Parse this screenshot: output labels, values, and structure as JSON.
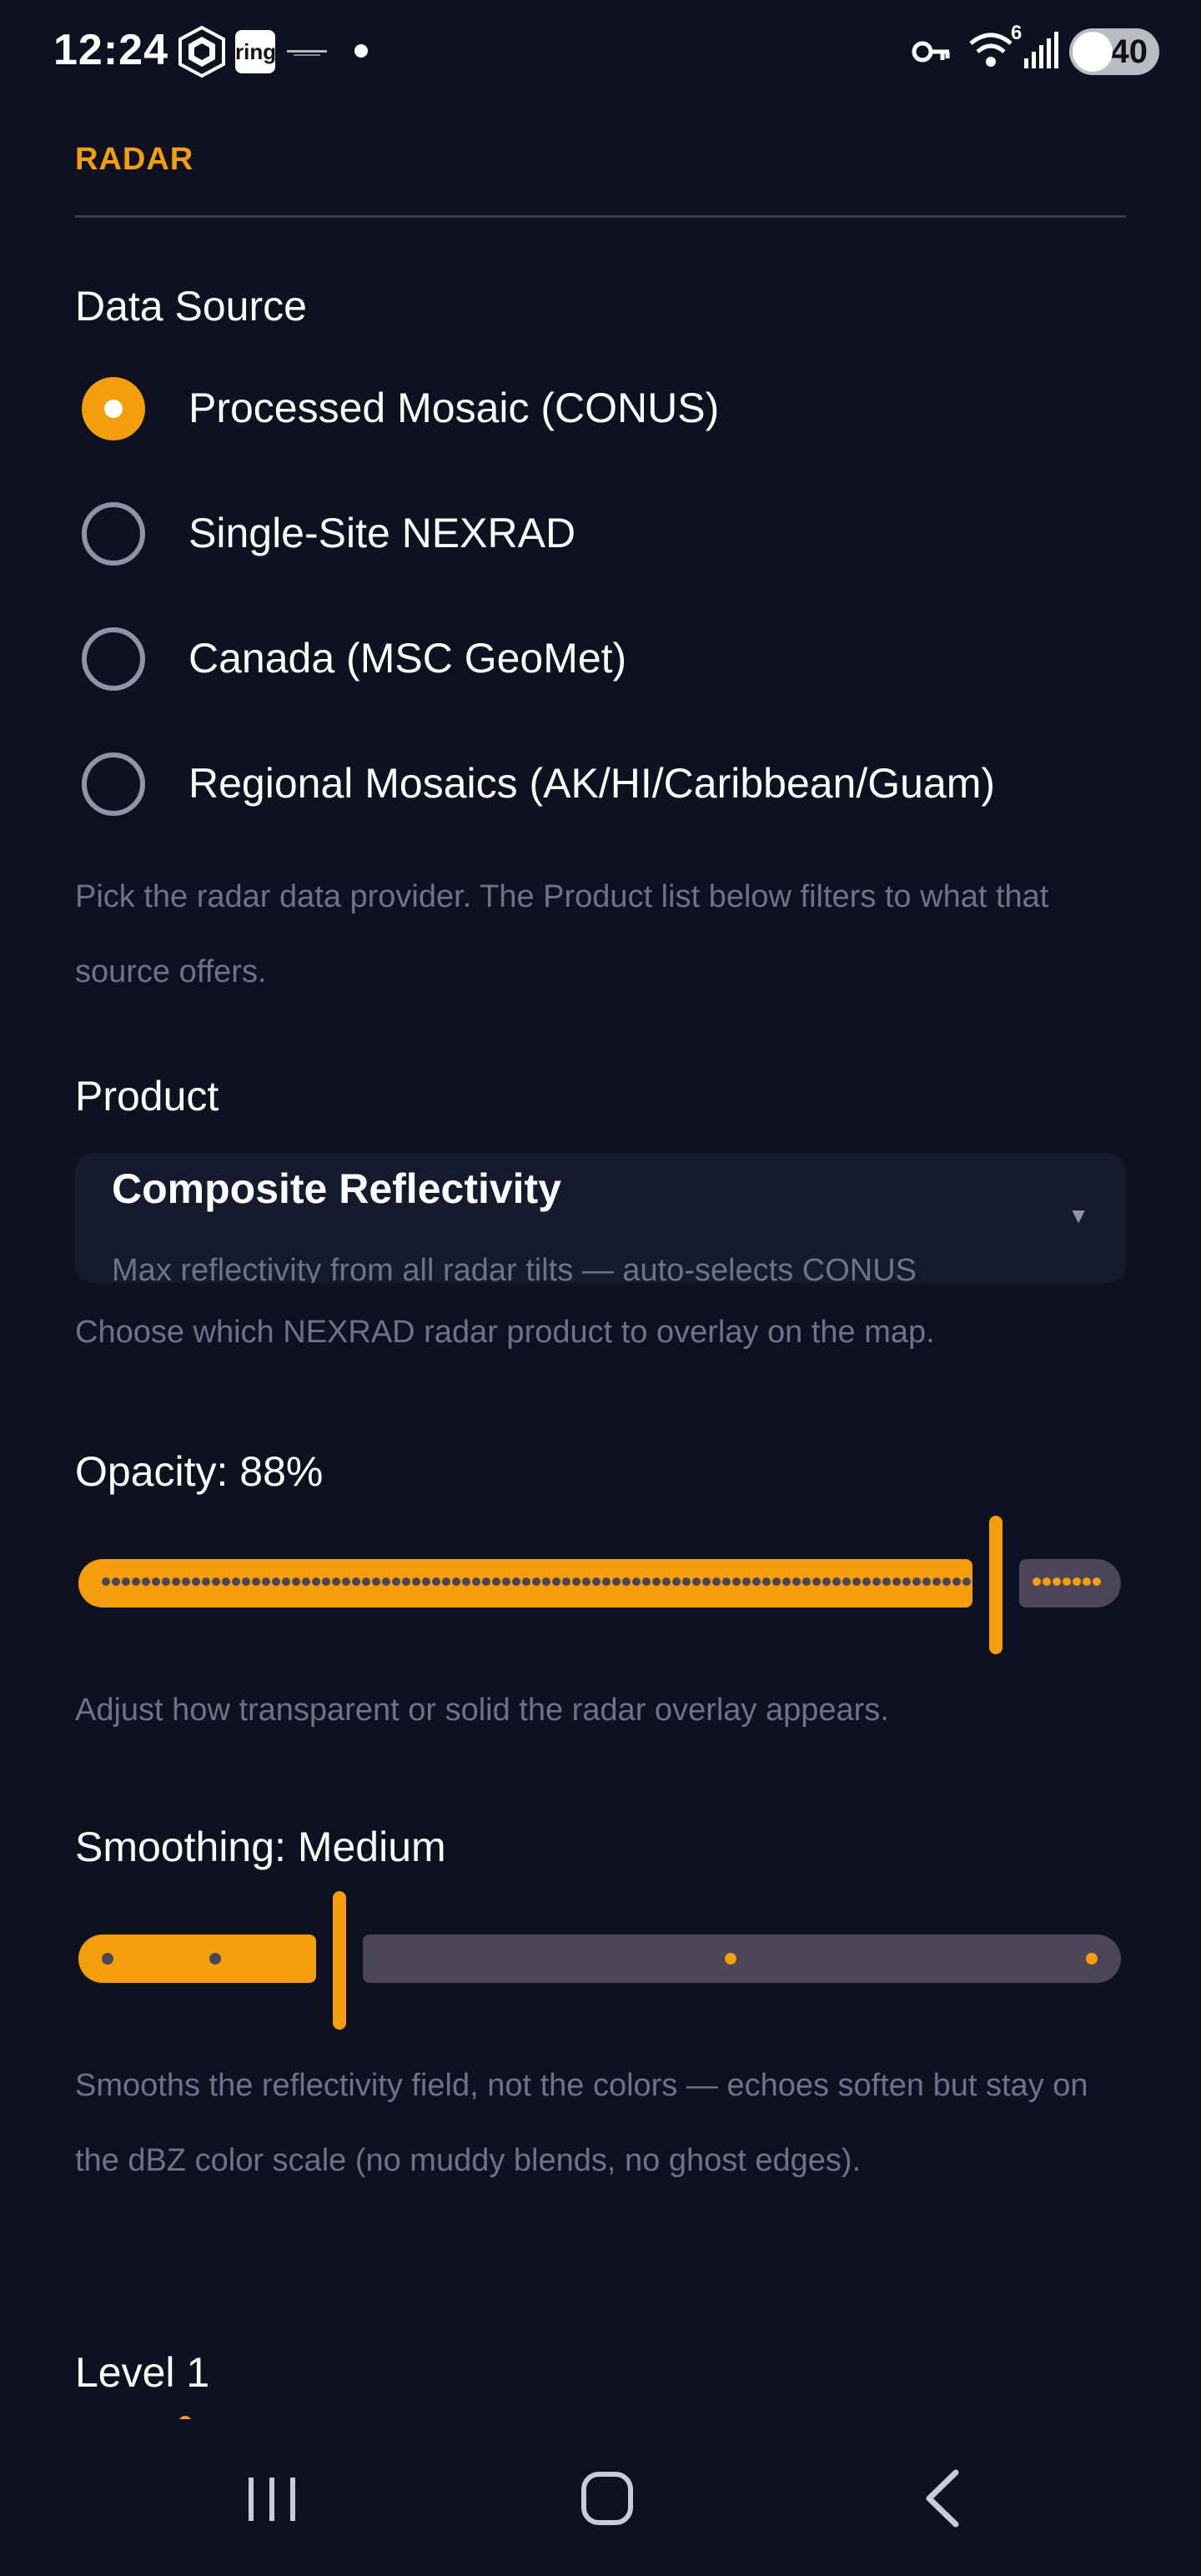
{
  "status_bar": {
    "time": "12:24",
    "notification_icons": [
      "crypto-com-icon",
      "ring-icon",
      "app-logo-icon",
      "dot-icon"
    ],
    "ring_label": "ring",
    "right_icons": [
      "key-icon",
      "wifi-6-icon",
      "signal-icon"
    ],
    "wifi_badge": "6",
    "battery": "40"
  },
  "section": {
    "title": "RADAR"
  },
  "data_source": {
    "label": "Data Source",
    "options": [
      {
        "label": "Processed Mosaic (CONUS)",
        "selected": true
      },
      {
        "label": "Single-Site NEXRAD",
        "selected": false
      },
      {
        "label": "Canada (MSC GeoMet)",
        "selected": false
      },
      {
        "label": "Regional Mosaics (AK/HI/Caribbean/Guam)",
        "selected": false
      }
    ],
    "help": "Pick the radar data provider. The Product list below filters to what that source offers."
  },
  "product": {
    "label": "Product",
    "selected_title": "Composite Reflectivity",
    "selected_description": "Max reflectivity from all radar tilts — auto-selects CONUS",
    "help": "Choose which NEXRAD radar product to overlay on the map."
  },
  "opacity": {
    "label": "Opacity: 88%",
    "value_percent": 88,
    "help": "Adjust how transparent or solid the radar overlay appears."
  },
  "smoothing": {
    "label": "Smoothing: Medium",
    "steps": 5,
    "selected_step": 2,
    "help": "Smooths the reflectivity field, not the colors — echoes soften but stay on the dBZ color scale (no muddy blends, no ghost edges)."
  },
  "level": {
    "label": "Level 1"
  },
  "colors": {
    "accent": "#f59e0b",
    "background": "#0d1120",
    "track_inactive": "#4b4658",
    "muted_text": "#6c7489"
  },
  "nav_bar": {
    "icons": [
      "recent-apps-icon",
      "home-icon",
      "back-icon"
    ]
  }
}
